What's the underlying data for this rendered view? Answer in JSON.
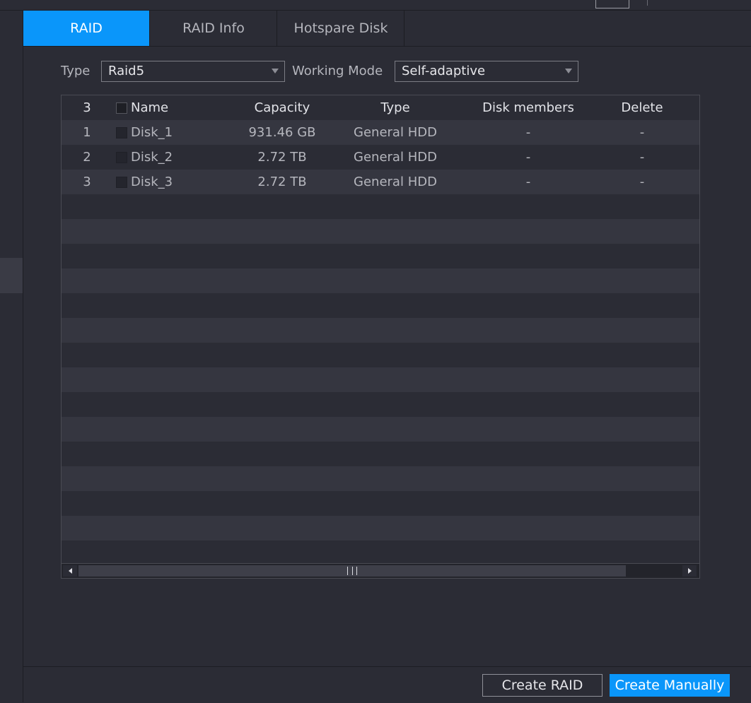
{
  "tabs": [
    {
      "label": "RAID"
    },
    {
      "label": "RAID Info"
    },
    {
      "label": "Hotspare Disk"
    }
  ],
  "filters": {
    "type_label": "Type",
    "type_value": "Raid5",
    "mode_label": "Working Mode",
    "mode_value": "Self-adaptive"
  },
  "table": {
    "count": "3",
    "headers": {
      "name": "Name",
      "capacity": "Capacity",
      "type": "Type",
      "members": "Disk members",
      "delete": "Delete"
    },
    "rows": [
      {
        "idx": "1",
        "name": "Disk_1",
        "capacity": "931.46 GB",
        "type": "General HDD",
        "members": "-",
        "delete": "-"
      },
      {
        "idx": "2",
        "name": "Disk_2",
        "capacity": "2.72 TB",
        "type": "General HDD",
        "members": "-",
        "delete": "-"
      },
      {
        "idx": "3",
        "name": "Disk_3",
        "capacity": "2.72 TB",
        "type": "General HDD",
        "members": "-",
        "delete": "-"
      }
    ]
  },
  "buttons": {
    "create_raid": "Create RAID",
    "create_manually": "Create Manually"
  },
  "colors": {
    "accent": "#0a96fa",
    "background": "#2b2c35",
    "row_alt": "#353640"
  }
}
